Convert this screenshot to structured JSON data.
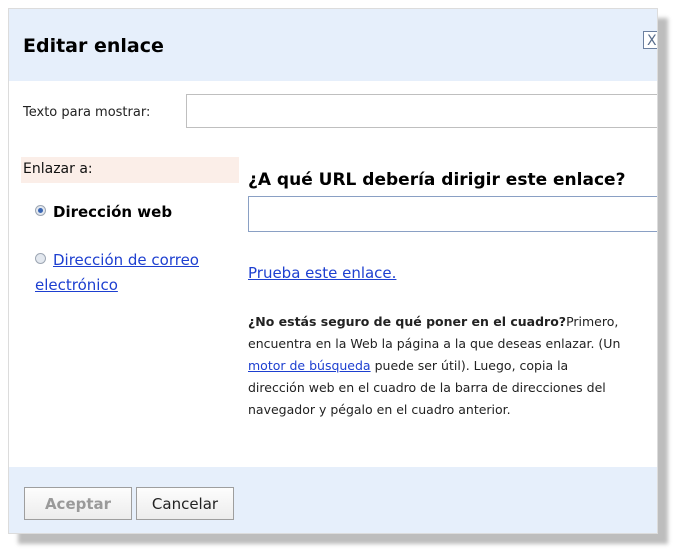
{
  "dialog": {
    "title": "Editar enlace",
    "close_label": "X"
  },
  "display_text": {
    "label": "Texto para mostrar:",
    "value": "",
    "placeholder": ""
  },
  "link_to": {
    "label": "Enlazar a:",
    "options": [
      {
        "label": "Dirección web",
        "selected": true
      },
      {
        "label": "Dirección de correo electrónico",
        "selected": false
      }
    ]
  },
  "url": {
    "question": "¿A qué URL debería dirigir este enlace?",
    "value": "",
    "placeholder": ""
  },
  "test_link": "Prueba este enlace.",
  "help": {
    "lead": "¿No estás seguro de qué poner en el cuadro?",
    "text_1": "Primero, encuentra en la Web la página a la que deseas enlazar. (Un",
    "link": "motor de búsqueda",
    "text_2": "puede ser útil). Luego, copia la dirección web en el cuadro de la barra de direcciones del navegador y pégalo en el cuadro anterior."
  },
  "buttons": {
    "accept": "Aceptar",
    "cancel": "Cancelar"
  },
  "colors": {
    "header_bg": "#e6effb",
    "footer_bg": "#e6effb",
    "link": "#1d3fd0",
    "label_highlight": "#fbeee8",
    "disabled_text": "#9a9a9a"
  }
}
